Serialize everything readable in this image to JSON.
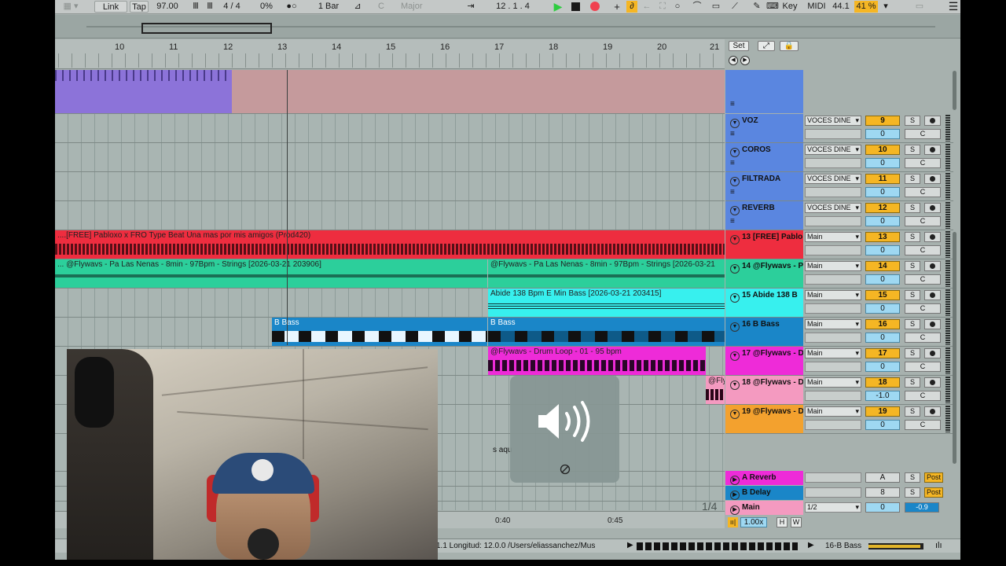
{
  "control_bar": {
    "link": "Link",
    "tap": "Tap",
    "tempo": "97.00",
    "time_signature": "4 / 4",
    "groove": "0%",
    "quantize": "1 Bar",
    "key_root": "C",
    "scale": "Major",
    "position": "12 .   1 .   4",
    "key_label": "Key",
    "midi_label": "MIDI",
    "sample_rate": "44.1",
    "cpu": "41 %"
  },
  "ruler": {
    "bars": [
      "10",
      "11",
      "12",
      "13",
      "14",
      "15",
      "16",
      "17",
      "18",
      "19",
      "20",
      "21"
    ]
  },
  "set_buttons": {
    "set": "Set"
  },
  "clips": {
    "track13": "....[FREE] Pabloxo x FRO  Type Beat  Una mas por mis amigos  (Prod420)",
    "track14_a": "... @Flywavs - Pa Las Nenas - 8min - 97Bpm - Strings [2026-03-21 203906]",
    "track14_b": "@Flywavs - Pa Las Nenas - 8min - 97Bpm - Strings [2026-03-21",
    "track15": "Abide 138 Bpm E Min Bass [2026-03-21 203415]",
    "track16_a": "B Bass",
    "track16_b": "B Bass",
    "track17": "@Flywavs - Drum Loop - 01 - 95 bpm",
    "track18": "@Fly"
  },
  "tracks": [
    {
      "name": "VOZ",
      "io": "VOCES DINE",
      "num": "9",
      "vol": "0",
      "color": "#5a86e0"
    },
    {
      "name": "COROS",
      "io": "VOCES DINE",
      "num": "10",
      "vol": "0",
      "color": "#5a86e0"
    },
    {
      "name": "FILTRADA",
      "io": "VOCES DINE",
      "num": "11",
      "vol": "0",
      "color": "#5a86e0"
    },
    {
      "name": "REVERB",
      "io": "VOCES DINE",
      "num": "12",
      "vol": "0",
      "color": "#5a86e0"
    },
    {
      "name": "13 [FREE] Pablo",
      "io": "Main",
      "num": "13",
      "vol": "0",
      "color": "#ee2d3f"
    },
    {
      "name": "14 @Flywavs - P",
      "io": "Main",
      "num": "14",
      "vol": "0",
      "color": "#2ccf9b"
    },
    {
      "name": "15 Abide 138 B",
      "io": "Main",
      "num": "15",
      "vol": "0",
      "color": "#37f0ee"
    },
    {
      "name": "16 B Bass",
      "io": "Main",
      "num": "16",
      "vol": "0",
      "color": "#1a86c8"
    },
    {
      "name": "17 @Flywavs - D",
      "io": "Main",
      "num": "17",
      "vol": "0",
      "color": "#ee2bd8"
    },
    {
      "name": "18 @Flywavs - D",
      "io": "Main",
      "num": "18",
      "vol": "-1.0",
      "color": "#f49ac0"
    },
    {
      "name": "19 @Flywavs - D",
      "io": "Main",
      "num": "19",
      "vol": "0",
      "color": "#f3a12e"
    }
  ],
  "track_common": {
    "solo": "S",
    "center": "C"
  },
  "returns": [
    {
      "name": "A Reverb",
      "letter": "A",
      "s": "S",
      "post": "Post",
      "color": "#ee2bd8"
    },
    {
      "name": "B Delay",
      "letter": "8",
      "s": "S",
      "post": "Post",
      "color": "#1a86c8"
    }
  ],
  "main": {
    "name": "Main",
    "io": "1/2",
    "vol": "0",
    "pan": "-0.9"
  },
  "time_ruler": {
    "t1": "0:40",
    "t2": "0:45"
  },
  "page_indicator": "1/4",
  "zoom": "1.00x",
  "zoom_h": "H",
  "zoom_w": "W",
  "trk_list_label": "s aqu",
  "status": {
    "text": "1.1  Longitud: 12.0.0  /Users/eliassanchez/Mus",
    "track": "16-B Bass"
  }
}
